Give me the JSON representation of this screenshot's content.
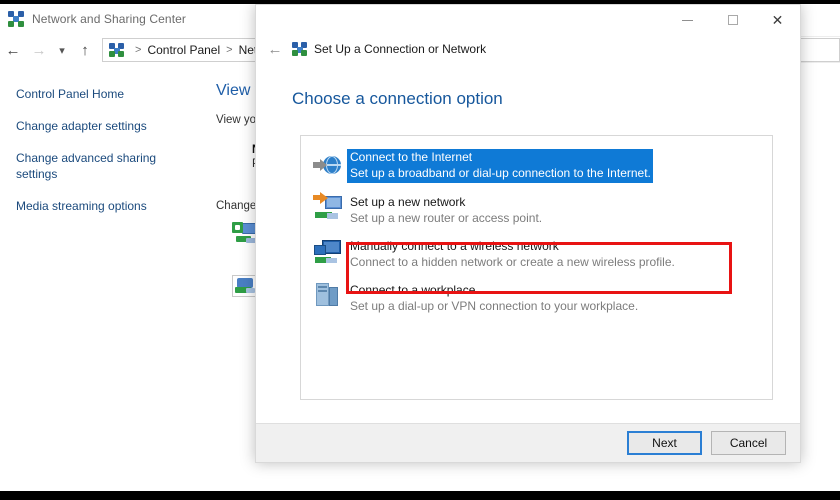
{
  "background_window": {
    "title": "Network and Sharing Center",
    "title_icon": "network-icon",
    "nav": {
      "back_icon": "back-arrow-icon",
      "forward_icon": "forward-arrow-icon",
      "recent_icon": "chevron-down-icon",
      "up_icon": "up-arrow-icon",
      "address_icon": "network-icon",
      "breadcrumbs": [
        "Control Panel",
        "Netw"
      ],
      "separator": ">"
    },
    "sidebar": {
      "items": [
        {
          "label": "Control Panel Home"
        },
        {
          "label": "Change adapter settings"
        },
        {
          "label": "Change advanced sharing settings"
        },
        {
          "label": "Media streaming options"
        }
      ]
    },
    "content": {
      "heading": "View y",
      "subheading": "View yo",
      "network_name": "NGU",
      "network_type": "Publ",
      "change_heading": "Change",
      "icon_1": "new-connection-icon",
      "icon_2": "troubleshoot-icon"
    }
  },
  "dialog": {
    "window_controls": {
      "minimize": "minimize-icon",
      "maximize": "maximize-icon",
      "close": "✕"
    },
    "back_arrow": "←",
    "title_icon": "network-icon",
    "title": "Set Up a Connection or Network",
    "heading": "Choose a connection option",
    "options": [
      {
        "title": "Connect to the Internet",
        "desc": "Set up a broadband or dial-up connection to the Internet.",
        "icon": "internet-globe-icon",
        "selected": true,
        "highlighted": false
      },
      {
        "title": "Set up a new network",
        "desc": "Set up a new router or access point.",
        "icon": "new-network-icon",
        "selected": false,
        "highlighted": false
      },
      {
        "title": "Manually connect to a wireless network",
        "desc": "Connect to a hidden network or create a new wireless profile.",
        "icon": "wireless-network-icon",
        "selected": false,
        "highlighted": true
      },
      {
        "title": "Connect to a workplace",
        "desc": "Set up a dial-up or VPN connection to your workplace.",
        "icon": "workplace-server-icon",
        "selected": false,
        "highlighted": false
      }
    ],
    "footer": {
      "next_label": "Next",
      "cancel_label": "Cancel"
    }
  },
  "colors": {
    "selection_blue": "#0f7ad6",
    "highlight_red": "#e81313",
    "heading_blue": "#16579c",
    "link_blue": "#1b4a7d",
    "primary_button_border": "#2b7fd4"
  }
}
